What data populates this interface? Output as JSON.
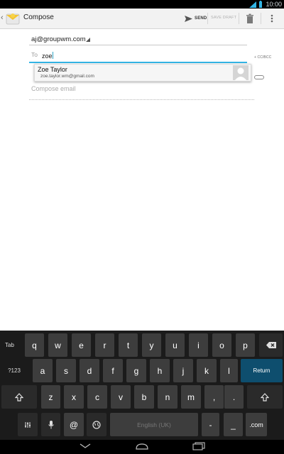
{
  "status": {
    "time": "10:00"
  },
  "actionbar": {
    "title": "Compose",
    "send_label": "SEND",
    "save_draft_label": "SAVE DRAFT"
  },
  "compose": {
    "from": "aj@groupwm.com",
    "to_label": "To",
    "to_value": "zoe",
    "cc_bcc_label": "+ CC/BCC",
    "body_placeholder": "Compose email"
  },
  "suggestion": {
    "name": "Zoe Taylor",
    "email": "zoe.taylor.wm@gmail.com"
  },
  "keyboard": {
    "row1": [
      "Tab",
      "q",
      "w",
      "e",
      "r",
      "t",
      "y",
      "u",
      "i",
      "o",
      "p"
    ],
    "row2": [
      "?123",
      "a",
      "s",
      "d",
      "f",
      "g",
      "h",
      "j",
      "k",
      "l",
      "Return"
    ],
    "row3": [
      "z",
      "x",
      "c",
      "v",
      "b",
      "n",
      "m",
      ",",
      "."
    ],
    "row4": [
      "@",
      "English (UK)",
      "-",
      "_",
      ".com"
    ]
  },
  "colors": {
    "accent": "#33b5e5",
    "return_key": "#0e4e6e",
    "keyboard_bg": "#1b1b1b"
  }
}
